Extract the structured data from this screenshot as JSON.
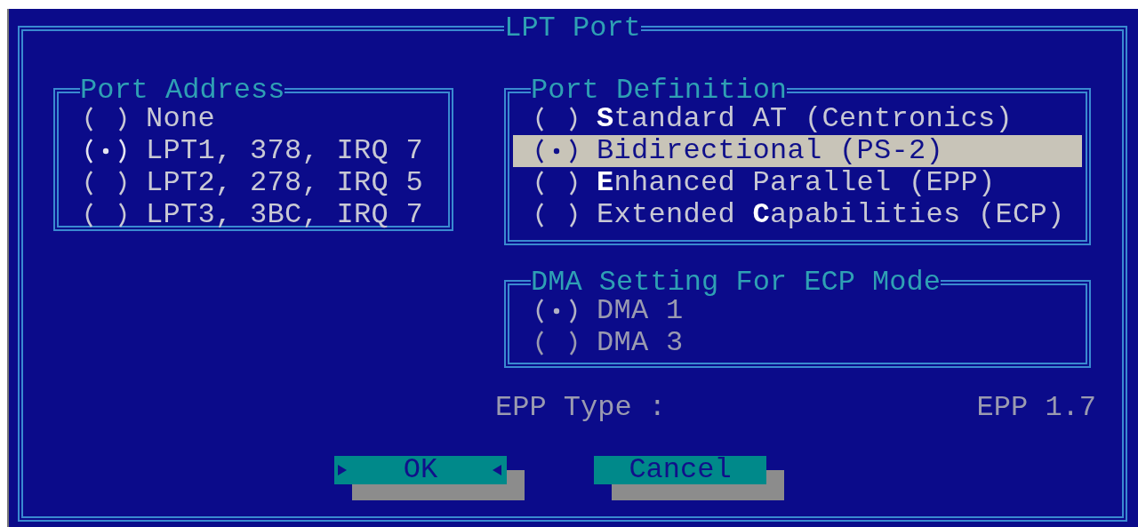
{
  "dialog": {
    "title": "LPT Port"
  },
  "port_address": {
    "title": "Port Address",
    "disabled": false,
    "options": [
      {
        "label": "None",
        "selected": false
      },
      {
        "label": "LPT1, 378, IRQ 7",
        "selected": true
      },
      {
        "label": "LPT2, 278, IRQ 5",
        "selected": false
      },
      {
        "label": "LPT3, 3BC, IRQ 7",
        "selected": false
      }
    ]
  },
  "port_definition": {
    "title": "Port Definition",
    "disabled": false,
    "options": [
      {
        "label": "**S**tandard AT (Centronics)",
        "selected": false,
        "highlighted": false
      },
      {
        "label": "Bidirectional (PS-2)",
        "selected": true,
        "highlighted": true
      },
      {
        "label": "**E**nhanced Parallel (EPP)",
        "selected": false,
        "highlighted": false
      },
      {
        "label": "Extended **C**apabilities (ECP)",
        "selected": false,
        "highlighted": false
      }
    ]
  },
  "dma_setting": {
    "title": "DMA Setting For ECP Mode",
    "disabled": true,
    "options": [
      {
        "label": "DMA 1",
        "selected": true
      },
      {
        "label": "DMA 3",
        "selected": false
      }
    ]
  },
  "epp_type": {
    "label": "EPP Type :",
    "value": "EPP 1.7",
    "disabled": true
  },
  "buttons": [
    {
      "label": "OK",
      "focused": true
    },
    {
      "label": "Cancel",
      "focused": false
    }
  ]
}
